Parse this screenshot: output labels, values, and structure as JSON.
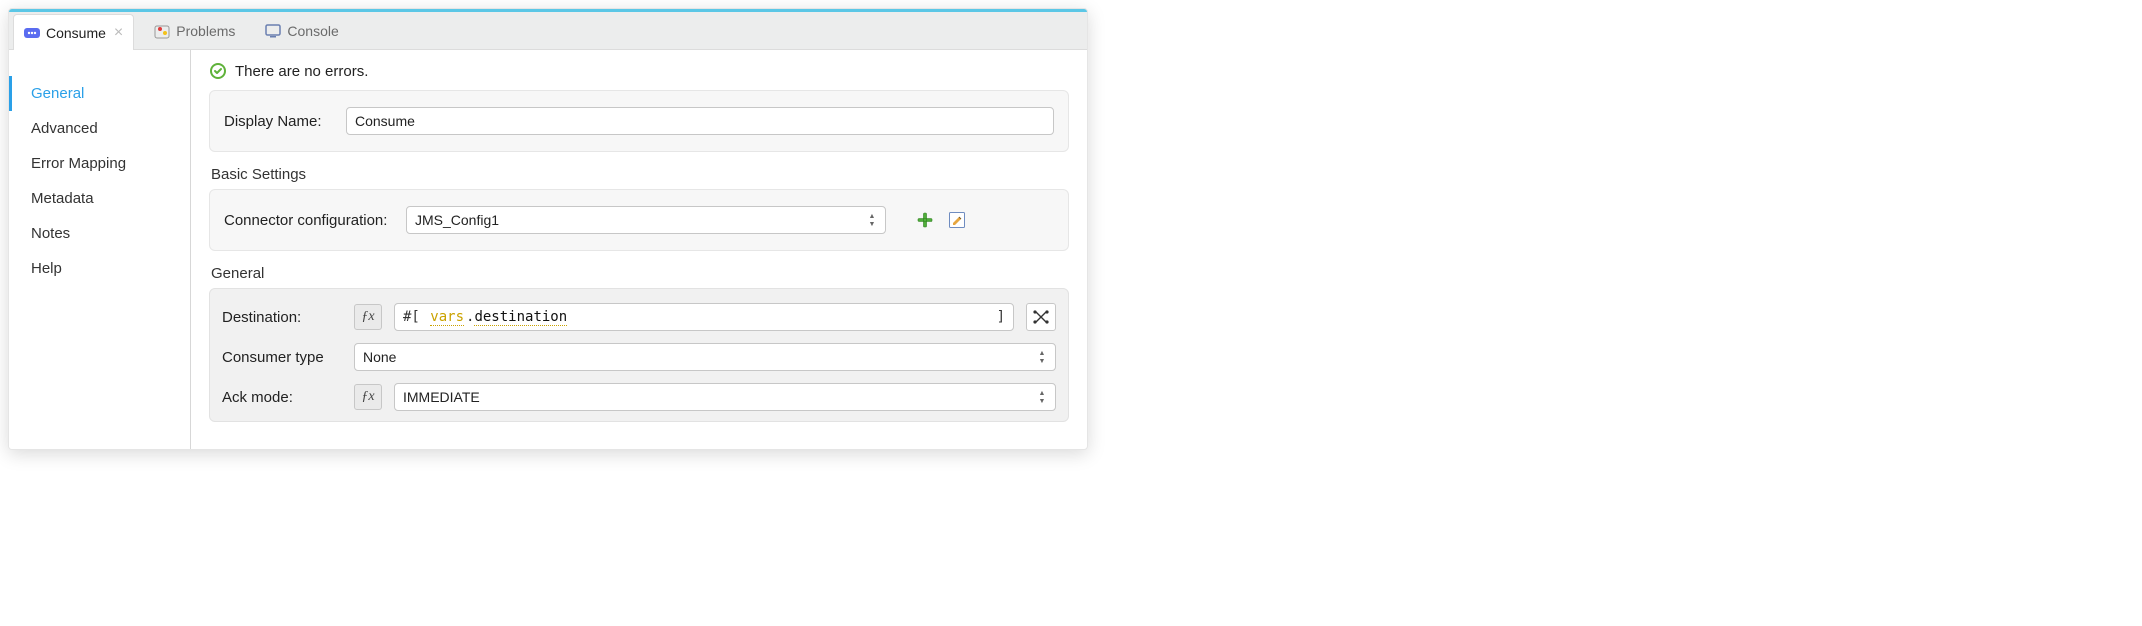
{
  "tabs": {
    "consume": "Consume",
    "problems": "Problems",
    "console": "Console"
  },
  "sidebar": {
    "items": [
      {
        "label": "General"
      },
      {
        "label": "Advanced"
      },
      {
        "label": "Error Mapping"
      },
      {
        "label": "Metadata"
      },
      {
        "label": "Notes"
      },
      {
        "label": "Help"
      }
    ],
    "selectedIndex": 0
  },
  "status": {
    "message": "There are no errors."
  },
  "form": {
    "displayNameLabel": "Display Name:",
    "displayNameValue": "Consume",
    "basicSettingsTitle": "Basic Settings",
    "connectorConfigLabel": "Connector configuration:",
    "connectorConfigValue": "JMS_Config1",
    "generalTitle": "General",
    "destinationLabel": "Destination:",
    "destinationExpr": {
      "open": "#[",
      "kw": "vars",
      "dot": ".",
      "id": "destination",
      "close": "]"
    },
    "consumerTypeLabel": "Consumer type",
    "consumerTypeValue": "None",
    "ackModeLabel": "Ack mode:",
    "ackModeValue": "IMMEDIATE"
  },
  "icons": {
    "consumeTab": "consume-icon",
    "problemsTab": "problems-icon",
    "consoleTab": "console-icon",
    "ok": "ok-check-icon",
    "add": "add-icon",
    "edit": "edit-icon",
    "map": "map-icon"
  }
}
